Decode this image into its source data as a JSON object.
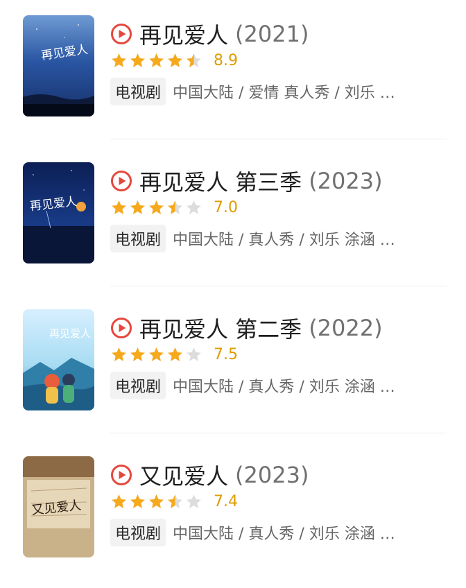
{
  "items": [
    {
      "title": "再见爱人",
      "year": "(2021)",
      "rating": 4.5,
      "score": "8.9",
      "tag": "电视剧",
      "info": "中国大陆 / 爱情 真人秀 / 刘乐 …",
      "poster_icon": "poster-ocean-blue",
      "poster_text": "再见爱人"
    },
    {
      "title": "再见爱人 第三季",
      "year": "(2023)",
      "rating": 3.5,
      "score": "7.0",
      "tag": "电视剧",
      "info": "中国大陆 / 真人秀 / 刘乐 涂涵 …",
      "poster_icon": "poster-night-sunset",
      "poster_text": "再见爱人"
    },
    {
      "title": "再见爱人 第二季",
      "year": "(2022)",
      "rating": 4,
      "score": "7.5",
      "tag": "电视剧",
      "info": "中国大陆 / 真人秀 / 刘乐 涂涵 …",
      "poster_icon": "poster-sky-illustration",
      "poster_text": "再见爱人"
    },
    {
      "title": "又见爱人",
      "year": "(2023)",
      "rating": 3.5,
      "score": "7.4",
      "tag": "电视剧",
      "info": "中国大陆 / 真人秀 / 刘乐 涂涵 …",
      "poster_icon": "poster-sepia-handwriting",
      "poster_text": "又见爱人"
    }
  ],
  "colors": {
    "play_icon": "#e5483e",
    "star_filled": "#f6a91b",
    "star_empty": "#dcdcdc",
    "score": "#e09b00",
    "tag_bg": "#f2f2f2"
  }
}
